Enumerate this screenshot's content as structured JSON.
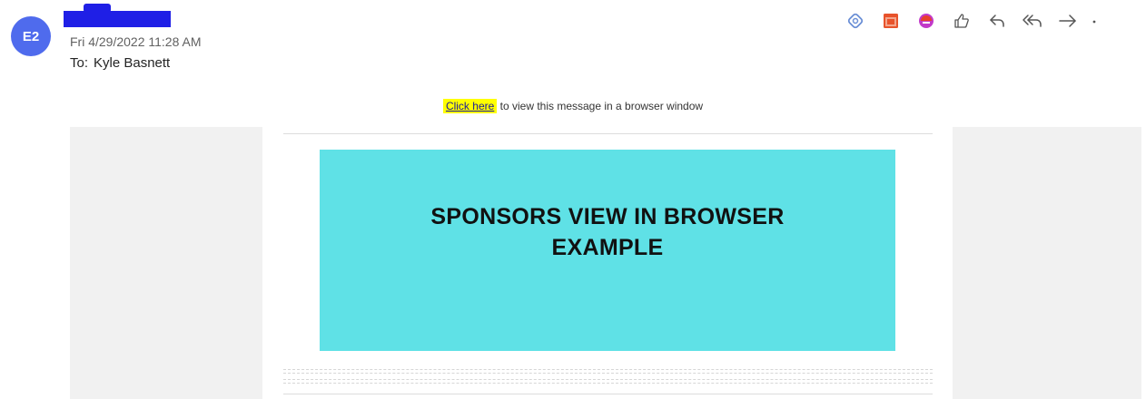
{
  "message": {
    "avatar_initials": "E2",
    "date": "Fri 4/29/2022 11:28 AM",
    "to_prefix": "To:",
    "to_name": "Kyle Basnett"
  },
  "toolbar": {
    "icons": [
      "loop-icon",
      "calendar-icon",
      "copilot-icon",
      "like-icon",
      "reply-icon",
      "reply-all-icon",
      "forward-icon",
      "more-icon"
    ]
  },
  "body": {
    "view_link": "Click here",
    "view_text": " to view this message in a browser window",
    "banner_line1": "SPONSORS VIEW IN BROWSER",
    "banner_line2": "EXAMPLE"
  },
  "colors": {
    "avatar": "#4f6bed",
    "banner": "#5fe1e6",
    "highlight": "#ffff00",
    "redaction": "#1f1fe6"
  }
}
